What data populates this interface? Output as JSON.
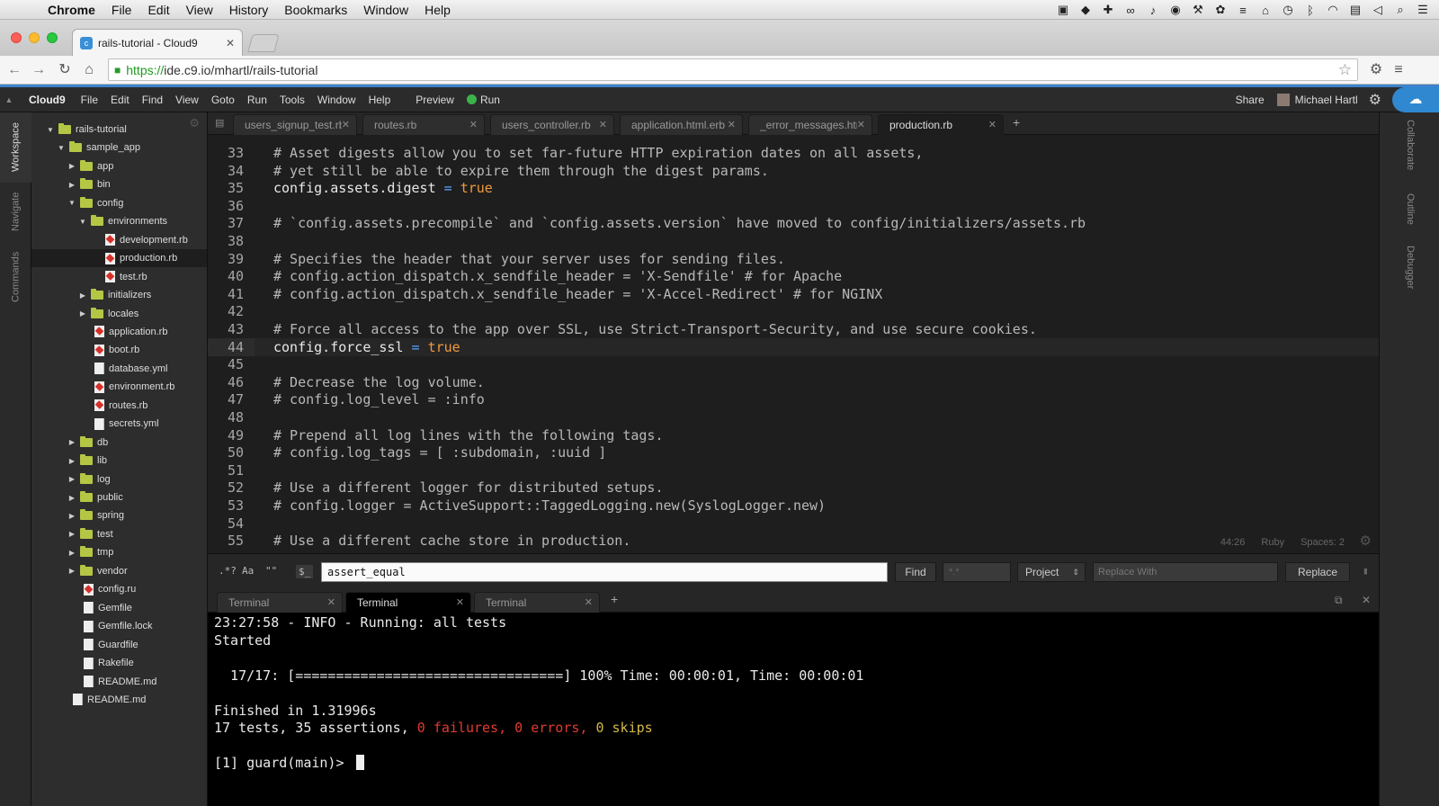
{
  "mac_menu": {
    "app": "Chrome",
    "items": [
      "File",
      "Edit",
      "View",
      "History",
      "Bookmarks",
      "Window",
      "Help"
    ]
  },
  "browser": {
    "tab_title": "rails-tutorial - Cloud9",
    "url_scheme": "https://",
    "url_rest": "ide.c9.io/mhartl/rails-tutorial"
  },
  "c9_menu": {
    "brand": "Cloud9",
    "items": [
      "File",
      "Edit",
      "Find",
      "View",
      "Goto",
      "Run",
      "Tools",
      "Window",
      "Help"
    ],
    "preview": "Preview",
    "run": "Run",
    "share": "Share",
    "user": "Michael Hartl"
  },
  "left_panel_tabs": [
    "Workspace",
    "Navigate",
    "Commands"
  ],
  "right_panel_tabs": [
    "Collaborate",
    "Outline",
    "Debugger"
  ],
  "file_tree": [
    {
      "name": "rails-tutorial",
      "type": "folder",
      "depth": 0,
      "open": true
    },
    {
      "name": "sample_app",
      "type": "folder",
      "depth": 1,
      "open": true
    },
    {
      "name": "app",
      "type": "folder",
      "depth": 2,
      "open": false
    },
    {
      "name": "bin",
      "type": "folder",
      "depth": 2,
      "open": false
    },
    {
      "name": "config",
      "type": "folder",
      "depth": 2,
      "open": true
    },
    {
      "name": "environments",
      "type": "folder",
      "depth": 3,
      "open": true
    },
    {
      "name": "development.rb",
      "type": "ruby",
      "depth": 4
    },
    {
      "name": "production.rb",
      "type": "ruby",
      "depth": 4,
      "selected": true
    },
    {
      "name": "test.rb",
      "type": "ruby",
      "depth": 4
    },
    {
      "name": "initializers",
      "type": "folder",
      "depth": 3,
      "open": false
    },
    {
      "name": "locales",
      "type": "folder",
      "depth": 3,
      "open": false
    },
    {
      "name": "application.rb",
      "type": "ruby",
      "depth": 3
    },
    {
      "name": "boot.rb",
      "type": "ruby",
      "depth": 3
    },
    {
      "name": "database.yml",
      "type": "text",
      "depth": 3
    },
    {
      "name": "environment.rb",
      "type": "ruby",
      "depth": 3
    },
    {
      "name": "routes.rb",
      "type": "ruby",
      "depth": 3
    },
    {
      "name": "secrets.yml",
      "type": "text",
      "depth": 3
    },
    {
      "name": "db",
      "type": "folder",
      "depth": 2,
      "open": false
    },
    {
      "name": "lib",
      "type": "folder",
      "depth": 2,
      "open": false
    },
    {
      "name": "log",
      "type": "folder",
      "depth": 2,
      "open": false
    },
    {
      "name": "public",
      "type": "folder",
      "depth": 2,
      "open": false
    },
    {
      "name": "spring",
      "type": "folder",
      "depth": 2,
      "open": false
    },
    {
      "name": "test",
      "type": "folder",
      "depth": 2,
      "open": false
    },
    {
      "name": "tmp",
      "type": "folder",
      "depth": 2,
      "open": false
    },
    {
      "name": "vendor",
      "type": "folder",
      "depth": 2,
      "open": false
    },
    {
      "name": "config.ru",
      "type": "ruby",
      "depth": 2
    },
    {
      "name": "Gemfile",
      "type": "text",
      "depth": 2
    },
    {
      "name": "Gemfile.lock",
      "type": "text",
      "depth": 2
    },
    {
      "name": "Guardfile",
      "type": "text",
      "depth": 2
    },
    {
      "name": "Rakefile",
      "type": "text",
      "depth": 2
    },
    {
      "name": "README.md",
      "type": "text",
      "depth": 2
    },
    {
      "name": "README.md",
      "type": "text",
      "depth": 1
    }
  ],
  "editor_tabs": [
    {
      "label": "users_signup_test.rb",
      "active": false
    },
    {
      "label": "routes.rb",
      "active": false
    },
    {
      "label": "users_controller.rb",
      "active": false
    },
    {
      "label": "application.html.erb",
      "active": false
    },
    {
      "label": "_error_messages.html.erb",
      "active": false
    },
    {
      "label": "production.rb",
      "active": true
    }
  ],
  "code_lines": [
    {
      "n": "33",
      "parts": [
        [
          "c",
          "# Asset digests allow you to set far-future HTTP expiration dates on all assets,"
        ]
      ]
    },
    {
      "n": "34",
      "parts": [
        [
          "c",
          "# yet still be able to expire them through the digest params."
        ]
      ]
    },
    {
      "n": "35",
      "parts": [
        [
          "t",
          "config.assets.digest "
        ],
        [
          "op",
          "="
        ],
        [
          "kw",
          " true"
        ]
      ]
    },
    {
      "n": "36",
      "parts": []
    },
    {
      "n": "37",
      "parts": [
        [
          "c",
          "# `config.assets.precompile` and `config.assets.version` have moved to config/initializers/assets.rb"
        ]
      ]
    },
    {
      "n": "38",
      "parts": []
    },
    {
      "n": "39",
      "parts": [
        [
          "c",
          "# Specifies the header that your server uses for sending files."
        ]
      ]
    },
    {
      "n": "40",
      "parts": [
        [
          "c",
          "# config.action_dispatch.x_sendfile_header = 'X-Sendfile' # for Apache"
        ]
      ]
    },
    {
      "n": "41",
      "parts": [
        [
          "c",
          "# config.action_dispatch.x_sendfile_header = 'X-Accel-Redirect' # for NGINX"
        ]
      ]
    },
    {
      "n": "42",
      "parts": []
    },
    {
      "n": "43",
      "parts": [
        [
          "c",
          "# Force all access to the app over SSL, use Strict-Transport-Security, and use secure cookies."
        ]
      ]
    },
    {
      "n": "44",
      "parts": [
        [
          "t",
          "config.force_ssl "
        ],
        [
          "op",
          "="
        ],
        [
          "kw",
          " true"
        ]
      ],
      "current": true
    },
    {
      "n": "45",
      "parts": []
    },
    {
      "n": "46",
      "parts": [
        [
          "c",
          "# Decrease the log volume."
        ]
      ]
    },
    {
      "n": "47",
      "parts": [
        [
          "c",
          "# config.log_level = :info"
        ]
      ]
    },
    {
      "n": "48",
      "parts": []
    },
    {
      "n": "49",
      "parts": [
        [
          "c",
          "# Prepend all log lines with the following tags."
        ]
      ]
    },
    {
      "n": "50",
      "parts": [
        [
          "c",
          "# config.log_tags = [ :subdomain, :uuid ]"
        ]
      ]
    },
    {
      "n": "51",
      "parts": []
    },
    {
      "n": "52",
      "parts": [
        [
          "c",
          "# Use a different logger for distributed setups."
        ]
      ]
    },
    {
      "n": "53",
      "parts": [
        [
          "c",
          "# config.logger = ActiveSupport::TaggedLogging.new(SyslogLogger.new)"
        ]
      ]
    },
    {
      "n": "54",
      "parts": []
    },
    {
      "n": "55",
      "parts": [
        [
          "c",
          "# Use a different cache store in production."
        ]
      ]
    }
  ],
  "editor_status": {
    "position": "44:26",
    "language": "Ruby",
    "spaces": "Spaces: 2"
  },
  "find_bar": {
    "regex_label": ".*?",
    "case_label": "Aa",
    "word_label": "\"\"",
    "console_label": "$_",
    "search_value": "assert_equal",
    "find_button": "Find",
    "filter_placeholder": "*.*",
    "scope": "Project",
    "replace_placeholder": "Replace With",
    "replace_button": "Replace"
  },
  "terminal_tabs": [
    {
      "label": "Terminal",
      "active": false
    },
    {
      "label": "Terminal",
      "active": true
    },
    {
      "label": "Terminal",
      "active": false
    }
  ],
  "terminal_lines": [
    {
      "parts": [
        [
          "t",
          "23:27:58 - INFO - Running: all tests"
        ]
      ]
    },
    {
      "parts": [
        [
          "t",
          "Started"
        ]
      ]
    },
    {
      "parts": []
    },
    {
      "parts": [
        [
          "t",
          "  17/17: [=================================] 100% Time: 00:00:01, Time: 00:00:01"
        ]
      ]
    },
    {
      "parts": []
    },
    {
      "parts": [
        [
          "t",
          "Finished in 1.31996s"
        ]
      ]
    },
    {
      "parts": [
        [
          "t",
          "17 tests, 35 assertions, "
        ],
        [
          "red",
          "0 failures, 0 errors, "
        ],
        [
          "yel",
          "0 skips"
        ]
      ]
    },
    {
      "parts": []
    },
    {
      "parts": [
        [
          "t",
          "[1] guard(main)> "
        ]
      ],
      "cursor": true
    }
  ]
}
